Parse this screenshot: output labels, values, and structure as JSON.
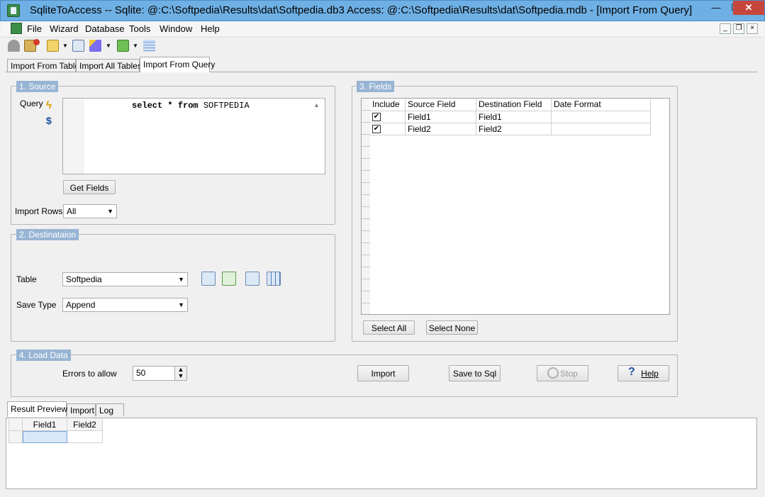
{
  "window": {
    "title": "SqliteToAccess -- Sqlite: @:C:\\Softpedia\\Results\\dat\\Softpedia.db3 Access: @:C:\\Softpedia\\Results\\dat\\Softpedia.mdb - [Import From Query]",
    "min_glyph": "—",
    "max_glyph": "☐",
    "close_glyph": "✕"
  },
  "menu": {
    "items": [
      "File",
      "Wizard",
      "Database",
      "Tools",
      "Window",
      "Help"
    ],
    "mdi_min": "_",
    "mdi_restore": "❐",
    "mdi_close": "×"
  },
  "toolbar": {
    "icons": [
      "connect-icon",
      "disconnect-icon",
      "wizard-icon",
      "import-icon",
      "magic-wand-icon",
      "export-icon",
      "grid-icon"
    ]
  },
  "tabs": [
    "Import From Table",
    "Import All Tables",
    "Import From Query"
  ],
  "active_tab": "Import From Query",
  "source": {
    "title": "1. Source",
    "query_label": "Query",
    "query_kw1": "select",
    "query_star": "*",
    "query_kw2": "from",
    "query_table": "SOFTPEDIA",
    "get_fields_label": "Get Fields",
    "import_rows_label": "Import Rows",
    "import_rows_value": "All"
  },
  "destination": {
    "title": "2. Destinataion",
    "table_label": "Table",
    "table_value": "Softpedia",
    "save_type_label": "Save Type",
    "save_type_value": "Append"
  },
  "fields": {
    "title": "3. Fields",
    "columns": [
      "Include",
      "Source Field",
      "Destination Field",
      "Date Format"
    ],
    "rows": [
      {
        "include": true,
        "source": "Field1",
        "destination": "Field1",
        "date_format": ""
      },
      {
        "include": true,
        "source": "Field2",
        "destination": "Field2",
        "date_format": ""
      }
    ],
    "select_all_label": "Select All",
    "select_none_label": "Select None"
  },
  "load_data": {
    "title": "4. Load Data",
    "errors_label": "Errors to allow",
    "errors_value": "50",
    "import_label": "Import",
    "save_sql_label": "Save to Sql",
    "stop_label": "Stop",
    "help_label": "Help"
  },
  "bottom_tabs": [
    "Result Preview",
    "Import",
    "Log"
  ],
  "active_bottom_tab": "Result Preview",
  "preview": {
    "columns": [
      "Field1",
      "Field2"
    ]
  },
  "colors": {
    "titlebar": "#6fb0e4",
    "group_title_bg": "#97b4d4",
    "close_button": "#c7463c"
  }
}
